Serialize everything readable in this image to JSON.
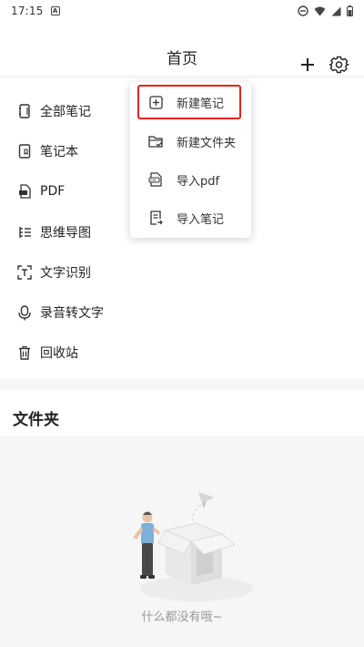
{
  "status_bar": {
    "time": "17:15",
    "notif_badge": "A"
  },
  "header": {
    "title": "首页"
  },
  "nav": {
    "items": [
      {
        "label": "全部笔记",
        "icon": "notebook-icon"
      },
      {
        "label": "笔记本",
        "icon": "notebook-bookmark-icon"
      },
      {
        "label": "PDF",
        "icon": "pdf-file-icon"
      },
      {
        "label": "思维导图",
        "icon": "mindmap-icon"
      },
      {
        "label": "文字识别",
        "icon": "ocr-scan-icon"
      },
      {
        "label": "录音转文字",
        "icon": "microphone-icon"
      },
      {
        "label": "回收站",
        "icon": "trash-icon"
      }
    ]
  },
  "popup_menu": {
    "items": [
      {
        "label": "新建笔记",
        "icon": "new-note-icon",
        "highlighted": true
      },
      {
        "label": "新建文件夹",
        "icon": "new-folder-icon"
      },
      {
        "label": "导入pdf",
        "icon": "import-pdf-icon"
      },
      {
        "label": "导入笔记",
        "icon": "import-note-icon"
      }
    ],
    "highlight_color": "#e0261d"
  },
  "folder_section": {
    "title": "文件夹",
    "empty_text": "什么都没有哦~"
  }
}
